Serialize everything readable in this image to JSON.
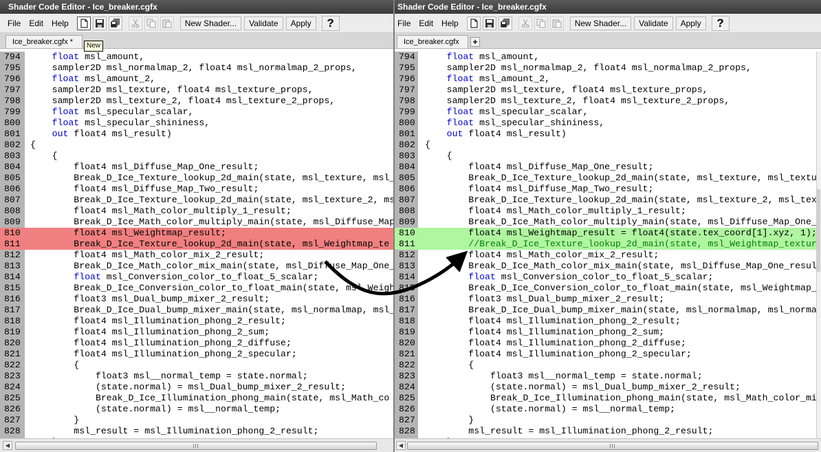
{
  "left": {
    "title": "Shader Code Editor - Ice_breaker.cgfx",
    "menu": [
      "File",
      "Edit",
      "Help"
    ],
    "buttons": {
      "new_shader": "New Shader...",
      "validate": "Validate",
      "apply": "Apply",
      "help": "?"
    },
    "tab_label": "Ice_breaker.cgfx *",
    "tooltip": "New",
    "lines": [
      {
        "n": "794",
        "t": "    float msl_amount,"
      },
      {
        "n": "795",
        "t": "    sampler2D msl_normalmap_2, float4 msl_normalmap_2_props,"
      },
      {
        "n": "796",
        "t": "    float msl_amount_2,"
      },
      {
        "n": "797",
        "t": "    sampler2D msl_texture, float4 msl_texture_props,"
      },
      {
        "n": "798",
        "t": "    sampler2D msl_texture_2, float4 msl_texture_2_props,"
      },
      {
        "n": "799",
        "t": "    float msl_specular_scalar,"
      },
      {
        "n": "800",
        "t": "    float msl_specular_shininess,"
      },
      {
        "n": "801",
        "t": "    out float4 msl_result)"
      },
      {
        "n": "802",
        "t": "{"
      },
      {
        "n": "803",
        "t": "    {"
      },
      {
        "n": "804",
        "t": "        float4 msl_Diffuse_Map_One_result;"
      },
      {
        "n": "805",
        "t": "        Break_D_Ice_Texture_lookup_2d_main(state, msl_texture, msl_"
      },
      {
        "n": "806",
        "t": "        float4 msl_Diffuse_Map_Two_result;"
      },
      {
        "n": "807",
        "t": "        Break_D_Ice_Texture_lookup_2d_main(state, msl_texture_2, ms"
      },
      {
        "n": "808",
        "t": "        float4 msl_Math_color_multiply_1_result;"
      },
      {
        "n": "809",
        "t": "        Break_D_Ice_Math_color_multiply_main(state, msl_Diffuse_Map"
      },
      {
        "n": "810",
        "t": "        float4 msl_Weightmap_result;"
      },
      {
        "n": "811",
        "t": "        Break_D_Ice_Texture_lookup_2d_main(state, msl_Weightmap_te"
      },
      {
        "n": "812",
        "t": "        float4 msl_Math_color_mix_2_result;"
      },
      {
        "n": "813",
        "t": "        Break_D_Ice_Math_color_mix_main(state, msl_Diffuse_Map_One_"
      },
      {
        "n": "814",
        "t": "        float msl_Conversion_color_to_float_5_scalar;"
      },
      {
        "n": "815",
        "t": "        Break_D_Ice_Conversion_color_to_float_main(state, msl_Weigh"
      },
      {
        "n": "816",
        "t": "        float3 msl_Dual_bump_mixer_2_result;"
      },
      {
        "n": "817",
        "t": "        Break_D_Ice_Dual_bump_mixer_main(state, msl_normalmap, msl_"
      },
      {
        "n": "818",
        "t": "        float4 msl_Illumination_phong_2_result;"
      },
      {
        "n": "819",
        "t": "        float4 msl_Illumination_phong_2_sum;"
      },
      {
        "n": "820",
        "t": "        float4 msl_Illumination_phong_2_diffuse;"
      },
      {
        "n": "821",
        "t": "        float4 msl_Illumination_phong_2_specular;"
      },
      {
        "n": "822",
        "t": "        {"
      },
      {
        "n": "823",
        "t": "            float3 msl__normal_temp = state.normal;"
      },
      {
        "n": "824",
        "t": "            (state.normal) = msl_Dual_bump_mixer_2_result;"
      },
      {
        "n": "825",
        "t": "            Break_D_Ice_Illumination_phong_main(state, msl_Math_co"
      },
      {
        "n": "826",
        "t": "            (state.normal) = msl__normal_temp;"
      },
      {
        "n": "827",
        "t": "        }"
      },
      {
        "n": "828",
        "t": "        msl_result = msl_Illumination_phong_2_result;"
      },
      {
        "n": "829",
        "t": "    }"
      }
    ]
  },
  "right": {
    "title": "Shader Code Editor - Ice_breaker.cgfx",
    "menu": [
      "File",
      "Edit",
      "Help"
    ],
    "buttons": {
      "new_shader": "New Shader...",
      "validate": "Validate",
      "apply": "Apply",
      "help": "?"
    },
    "tab_label": "Ice_breaker.cgfx",
    "tab_add": "+",
    "lines": [
      {
        "n": "794",
        "t": "    float msl_amount,"
      },
      {
        "n": "795",
        "t": "    sampler2D msl_normalmap_2, float4 msl_normalmap_2_props,"
      },
      {
        "n": "796",
        "t": "    float msl_amount_2,"
      },
      {
        "n": "797",
        "t": "    sampler2D msl_texture, float4 msl_texture_props,"
      },
      {
        "n": "798",
        "t": "    sampler2D msl_texture_2, float4 msl_texture_2_props,"
      },
      {
        "n": "799",
        "t": "    float msl_specular_scalar,"
      },
      {
        "n": "800",
        "t": "    float msl_specular_shininess,"
      },
      {
        "n": "801",
        "t": "    out float4 msl_result)"
      },
      {
        "n": "802",
        "t": "{"
      },
      {
        "n": "803",
        "t": "    {"
      },
      {
        "n": "804",
        "t": "        float4 msl_Diffuse_Map_One_result;"
      },
      {
        "n": "805",
        "t": "        Break_D_Ice_Texture_lookup_2d_main(state, msl_texture, msl_texture"
      },
      {
        "n": "806",
        "t": "        float4 msl_Diffuse_Map_Two_result;"
      },
      {
        "n": "807",
        "t": "        Break_D_Ice_Texture_lookup_2d_main(state, msl_texture_2, msl_textu"
      },
      {
        "n": "808",
        "t": "        float4 msl_Math_color_multiply_1_result;"
      },
      {
        "n": "809",
        "t": "        Break_D_Ice_Math_color_multiply_main(state, msl_Diffuse_Map_One_re"
      },
      {
        "n": "810",
        "t": "        float4 msl_Weightmap_result = float4(state.tex_coord[1].xyz, 1);"
      },
      {
        "n": "811",
        "t": "        //Break_D_Ice_Texture_lookup_2d_main(state, msl_Weightmap_texture"
      },
      {
        "n": "812",
        "t": "        float4 msl_Math_color_mix_2_result;"
      },
      {
        "n": "813",
        "t": "        Break_D_Ice_Math_color_mix_main(state, msl_Diffuse_Map_One_result"
      },
      {
        "n": "814",
        "t": "        float msl_Conversion_color_to_float_5_scalar;"
      },
      {
        "n": "815",
        "t": "        Break_D_Ice_Conversion_color_to_float_main(state, msl_Weightmap_re"
      },
      {
        "n": "816",
        "t": "        float3 msl_Dual_bump_mixer_2_result;"
      },
      {
        "n": "817",
        "t": "        Break_D_Ice_Dual_bump_mixer_main(state, msl_normalmap, msl_normalm"
      },
      {
        "n": "818",
        "t": "        float4 msl_Illumination_phong_2_result;"
      },
      {
        "n": "819",
        "t": "        float4 msl_Illumination_phong_2_sum;"
      },
      {
        "n": "820",
        "t": "        float4 msl_Illumination_phong_2_diffuse;"
      },
      {
        "n": "821",
        "t": "        float4 msl_Illumination_phong_2_specular;"
      },
      {
        "n": "822",
        "t": "        {"
      },
      {
        "n": "823",
        "t": "            float3 msl__normal_temp = state.normal;"
      },
      {
        "n": "824",
        "t": "            (state.normal) = msl_Dual_bump_mixer_2_result;"
      },
      {
        "n": "825",
        "t": "            Break_D_Ice_Illumination_phong_main(state, msl_Math_color_mix"
      },
      {
        "n": "826",
        "t": "            (state.normal) = msl__normal_temp;"
      },
      {
        "n": "827",
        "t": "        }"
      },
      {
        "n": "828",
        "t": "        msl_result = msl_Illumination_phong_2_result;"
      },
      {
        "n": "829",
        "t": "    }"
      }
    ]
  },
  "colors": {
    "removed_line": "#f08080",
    "added_line": "#b0f5a0",
    "keyword": "#0000d0",
    "comment": "#008000",
    "gutter": "#b5b5b5"
  }
}
